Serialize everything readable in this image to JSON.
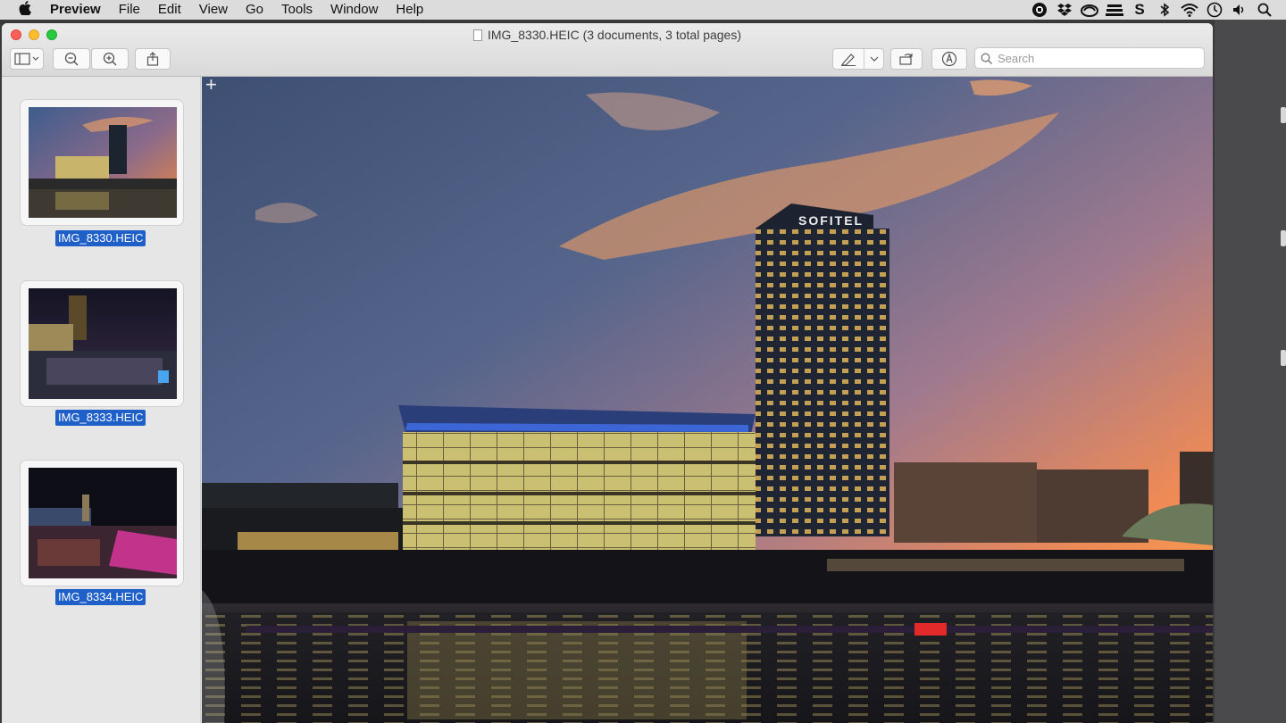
{
  "menubar": {
    "app": "Preview",
    "items": [
      "File",
      "Edit",
      "View",
      "Go",
      "Tools",
      "Window",
      "Help"
    ]
  },
  "window": {
    "title": "IMG_8330.HEIC (3 documents, 3 total pages)"
  },
  "toolbar": {
    "search_placeholder": "Search"
  },
  "sidebar": {
    "items": [
      {
        "label": "IMG_8330.HEIC"
      },
      {
        "label": "IMG_8333.HEIC"
      },
      {
        "label": "IMG_8334.HEIC"
      }
    ]
  },
  "photo": {
    "sign": "SOFITEL"
  },
  "colors": {
    "selection": "#1f5fc8",
    "close": "#fe5f57",
    "minimize": "#febc2e",
    "zoom": "#28c840"
  }
}
